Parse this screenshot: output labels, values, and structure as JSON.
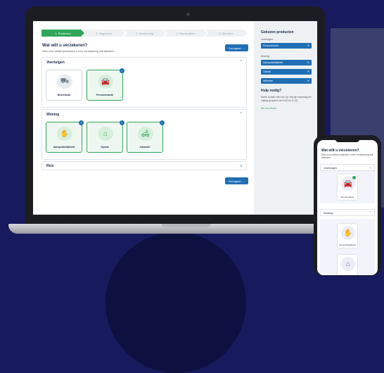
{
  "colors": {
    "background": "#171a5c",
    "accent": "#1f6fb5",
    "success": "#2fa65a"
  },
  "steps": [
    "1. Producten",
    "2. Gegevens",
    "3. Verzekering",
    "4. Premieopties",
    "5. Afronden"
  ],
  "main": {
    "title": "Wat wilt u verzekeren?",
    "subtitle": "Kies voor welke producten u een verzekering wilt afsluiten.",
    "next_label": "Doorgaan →",
    "sections": [
      {
        "title": "Voertuigen",
        "chevron": "^",
        "cards": [
          {
            "label": "Bestelauto",
            "selected": false,
            "icon": "van-icon"
          },
          {
            "label": "Personenauto",
            "selected": true,
            "icon": "car-icon"
          }
        ]
      },
      {
        "title": "Woning",
        "chevron": "^",
        "cards": [
          {
            "label": "Aansprakelijkheid",
            "selected": true,
            "icon": "hand-icon"
          },
          {
            "label": "Opstal",
            "selected": true,
            "icon": "house-icon"
          },
          {
            "label": "Inboedel",
            "selected": true,
            "icon": "sofa-icon"
          }
        ]
      },
      {
        "title": "Reis",
        "chevron": "v"
      }
    ]
  },
  "sidebar": {
    "title": "Gekozen producten",
    "vehicles_label": "Voertuigen",
    "vehicles": [
      "Personenauto"
    ],
    "home_label": "Woning",
    "home": [
      "Aansprakelijkheid",
      "Opstal",
      "Inboedel"
    ],
    "help_title": "Hulp nodig?",
    "help_text": "Neem contact met ons op. Wij zijn maandag t/m vrijdag geopend van 9:00 tot 17:00.",
    "help_link": "Bel ons direct"
  },
  "phone": {
    "title": "Wat wilt u verzekeren?",
    "subtitle": "Kies voor welke producten u een verzekering wilt afsluiten.",
    "section1": "Voertuigen",
    "card_label": "Personenauto",
    "section2": "Woning",
    "card2_label": "Aansprakelijkheid"
  }
}
